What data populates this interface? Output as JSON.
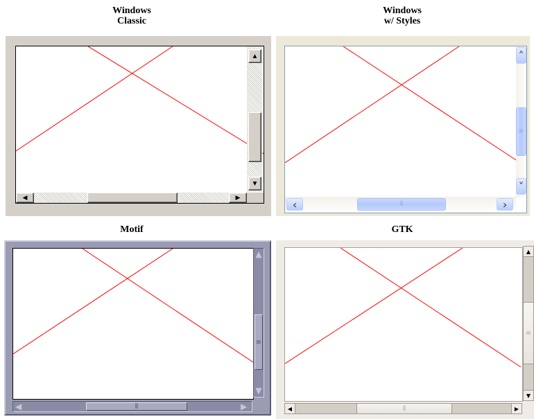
{
  "panels": {
    "windows_classic": {
      "caption_line1": "Windows",
      "caption_line2": "Classic"
    },
    "windows_styles": {
      "caption_line1": "Windows",
      "caption_line2": "w/ Styles"
    },
    "motif": {
      "caption": "Motif"
    },
    "gtk": {
      "caption": "GTK"
    }
  },
  "icons": {
    "arrow_up": "▲",
    "arrow_down": "▼",
    "arrow_left": "◀",
    "arrow_right": "▶",
    "chevron_up": "˄",
    "chevron_down": "˅",
    "chevron_left": "‹",
    "chevron_right": "›",
    "grip": "≡",
    "grip_h": "⦀"
  },
  "colors": {
    "line": "#ff0000",
    "classic_face": "#d4d0c8",
    "xp_face": "#ece9d8",
    "motif_face": "#9a9cb4",
    "gtk_face": "#efebe7"
  }
}
